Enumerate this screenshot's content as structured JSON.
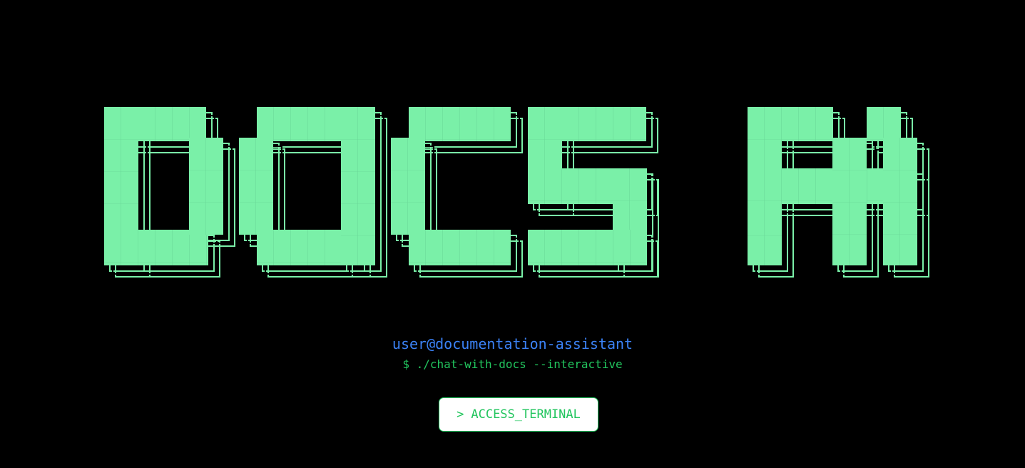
{
  "hero": {
    "logo_text": "DOCS AI",
    "fill_color": "#7af0a8",
    "outline_color": "#7af0a8"
  },
  "terminal": {
    "user_host": "user@documentation-assistant",
    "command": "$ ./chat-with-docs --interactive"
  },
  "access_button": {
    "prompt_symbol": ">",
    "label": "ACCESS_TERMINAL"
  },
  "colors": {
    "background": "#000000",
    "user_host": "#3b82f6",
    "command": "#22c55e",
    "button_border": "#22c55e",
    "button_bg": "#ffffff"
  }
}
